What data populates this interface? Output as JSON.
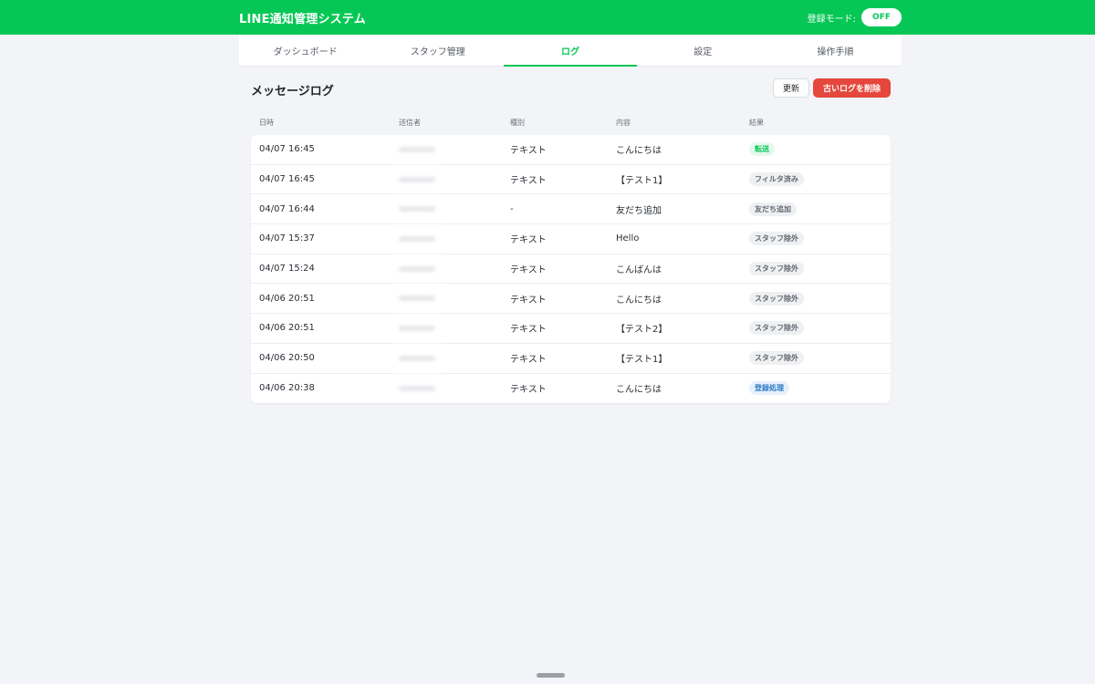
{
  "app": {
    "title": "LINE通知管理システム"
  },
  "mode": {
    "label": "登録モード:",
    "value": "OFF"
  },
  "nav": {
    "tabs": [
      {
        "label": "ダッシュボード",
        "active": false
      },
      {
        "label": "スタッフ管理",
        "active": false
      },
      {
        "label": "ログ",
        "active": true
      },
      {
        "label": "設定",
        "active": false
      },
      {
        "label": "操作手順",
        "active": false
      }
    ]
  },
  "page": {
    "title": "メッセージログ",
    "refresh_label": "更新",
    "delete_label": "古いログを削除"
  },
  "table": {
    "headers": {
      "date": "日時",
      "sender": "送信者",
      "type": "種別",
      "content": "内容",
      "result": "結果"
    },
    "rows": [
      {
        "date": "04/07 16:45",
        "type": "テキスト",
        "content": "こんにちは",
        "result": "転送",
        "result_style": "green"
      },
      {
        "date": "04/07 16:45",
        "type": "テキスト",
        "content": "【テスト1】",
        "result": "フィルタ済み",
        "result_style": "gray"
      },
      {
        "date": "04/07 16:44",
        "type": "-",
        "content": "友だち追加",
        "result": "友だち追加",
        "result_style": "gray"
      },
      {
        "date": "04/07 15:37",
        "type": "テキスト",
        "content": "Hello",
        "result": "スタッフ除外",
        "result_style": "gray"
      },
      {
        "date": "04/07 15:24",
        "type": "テキスト",
        "content": "こんばんは",
        "result": "スタッフ除外",
        "result_style": "gray"
      },
      {
        "date": "04/06 20:51",
        "type": "テキスト",
        "content": "こんにちは",
        "result": "スタッフ除外",
        "result_style": "gray"
      },
      {
        "date": "04/06 20:51",
        "type": "テキスト",
        "content": "【テスト2】",
        "result": "スタッフ除外",
        "result_style": "gray"
      },
      {
        "date": "04/06 20:50",
        "type": "テキスト",
        "content": "【テスト1】",
        "result": "スタッフ除外",
        "result_style": "gray"
      },
      {
        "date": "04/06 20:38",
        "type": "テキスト",
        "content": "こんにちは",
        "result": "登録処理",
        "result_style": "blue"
      }
    ]
  },
  "colors": {
    "brand": "#06c755",
    "danger": "#e5473c",
    "background": "#f3f4f7"
  }
}
